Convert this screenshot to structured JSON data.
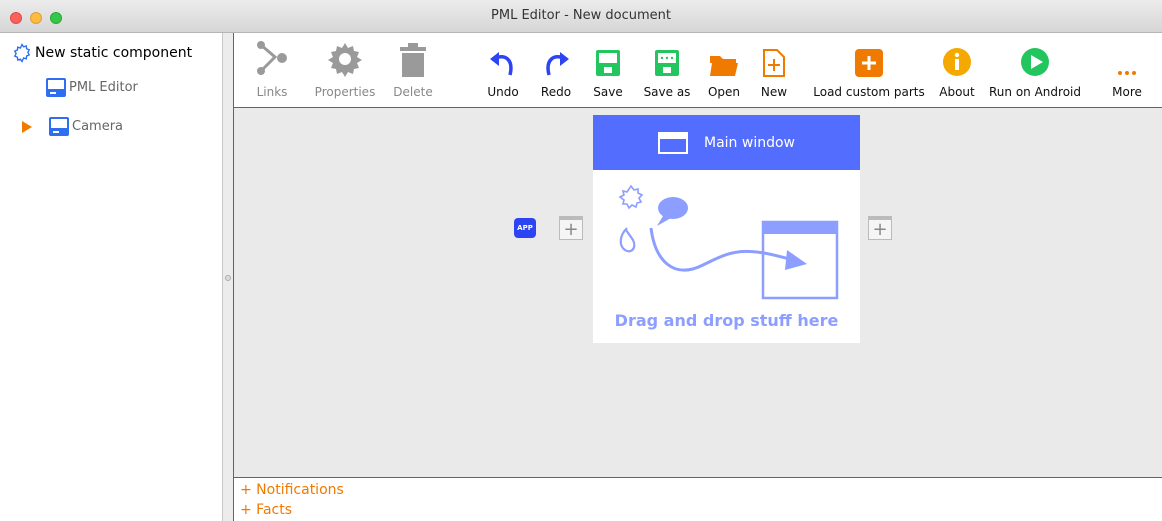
{
  "window": {
    "title": "PML Editor - New document"
  },
  "sidebar": {
    "items": [
      {
        "label": "New static component",
        "icon": "gear-outline-icon"
      },
      {
        "label": "PML Editor",
        "icon": "window-icon"
      },
      {
        "label": "Camera",
        "icon": "window-icon",
        "expander": "triangle-right-icon"
      }
    ]
  },
  "toolbar": {
    "buttons": [
      {
        "label": "Links",
        "icon": "links-icon",
        "enabled": false
      },
      {
        "label": "Properties",
        "icon": "gear-icon",
        "enabled": false
      },
      {
        "label": "Delete",
        "icon": "trash-icon",
        "enabled": false
      },
      {
        "label": "Undo",
        "icon": "undo-icon",
        "enabled": true
      },
      {
        "label": "Redo",
        "icon": "redo-icon",
        "enabled": true
      },
      {
        "label": "Save",
        "icon": "save-icon",
        "enabled": true
      },
      {
        "label": "Save as",
        "icon": "save-as-icon",
        "enabled": true
      },
      {
        "label": "Open",
        "icon": "folder-icon",
        "enabled": true
      },
      {
        "label": "New",
        "icon": "new-file-icon",
        "enabled": true
      },
      {
        "label": "Load custom parts",
        "icon": "plus-box-icon",
        "enabled": true
      },
      {
        "label": "About",
        "icon": "info-icon",
        "enabled": true
      },
      {
        "label": "Run on Android",
        "icon": "play-icon",
        "enabled": true
      },
      {
        "label": "More",
        "icon": "more-icon",
        "enabled": true
      }
    ]
  },
  "canvas": {
    "main_window": {
      "title": "Main window",
      "hint": "Drag and drop stuff here"
    },
    "app_badge": "APP"
  },
  "bottom_panel": {
    "notifications": "+ Notifications",
    "facts": "+ Facts"
  },
  "colors": {
    "accent_blue": "#536dfe",
    "orange": "#f07a00",
    "green": "#22c55e",
    "disabled_gray": "#888888"
  }
}
